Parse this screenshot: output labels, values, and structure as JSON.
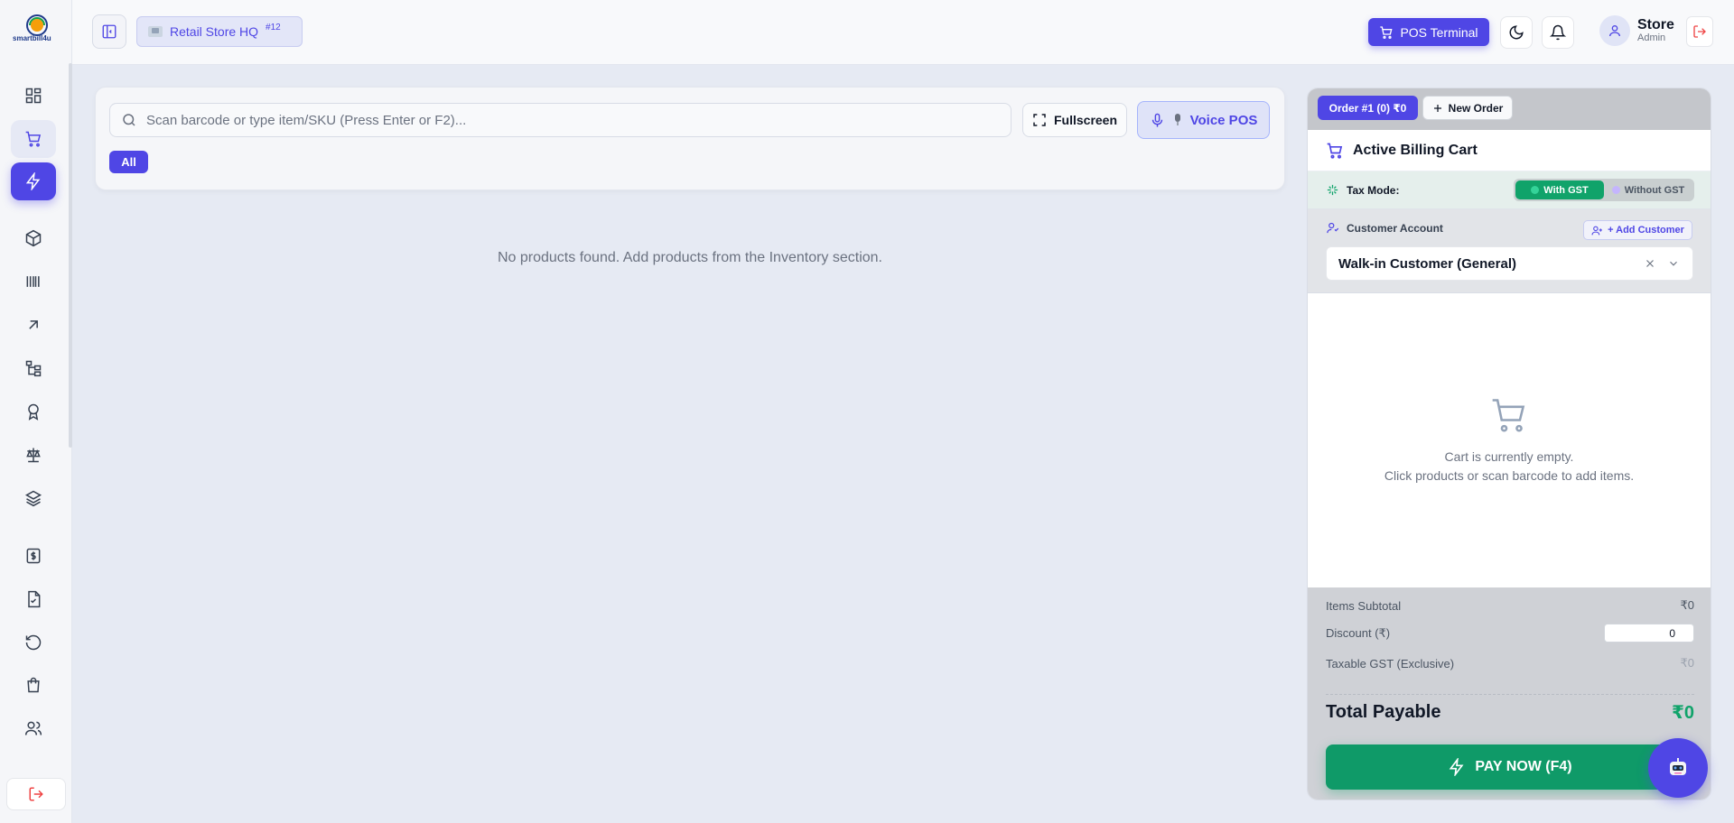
{
  "brand": {
    "logo_text": "smartbill4u"
  },
  "sidebar": {
    "items": [
      {
        "name": "dashboard",
        "icon": "grid-icon"
      },
      {
        "name": "pos",
        "icon": "cart-icon"
      },
      {
        "name": "quick-billing",
        "icon": "lightning-icon"
      },
      {
        "name": "products",
        "icon": "box-icon"
      },
      {
        "name": "barcodes",
        "icon": "barcode-icon"
      },
      {
        "name": "purchases",
        "icon": "arrow-up-right-icon"
      },
      {
        "name": "categories",
        "icon": "hierarchy-icon"
      },
      {
        "name": "loyalty",
        "icon": "award-icon"
      },
      {
        "name": "accounts",
        "icon": "scale-icon"
      },
      {
        "name": "stock",
        "icon": "layers-icon"
      },
      {
        "name": "expenses",
        "icon": "receipt-icon"
      },
      {
        "name": "reports",
        "icon": "file-check-icon"
      },
      {
        "name": "returns",
        "icon": "undo-icon"
      },
      {
        "name": "orders",
        "icon": "bag-icon"
      },
      {
        "name": "customers",
        "icon": "users-icon"
      }
    ]
  },
  "topbar": {
    "store_name": "Retail Store HQ",
    "store_id": "#12",
    "pos_button": "POS Terminal",
    "user_name": "Store",
    "user_role": "Admin"
  },
  "search": {
    "placeholder": "Scan barcode or type item/SKU (Press Enter or F2)...",
    "fullscreen_label": "Fullscreen",
    "voice_label": "Voice POS",
    "category_all": "All"
  },
  "main": {
    "empty_message": "No products found. Add products from the Inventory section."
  },
  "cart": {
    "order_tab": "Order #1 (0) ₹0",
    "new_order": "New Order",
    "title": "Active Billing Cart",
    "tax_mode_label": "Tax Mode:",
    "tax_with": "With GST",
    "tax_without": "Without GST",
    "customer_label": "Customer Account",
    "add_customer": "+ Add Customer",
    "customer_selected": "Walk-in Customer (General)",
    "empty_line1": "Cart is currently empty.",
    "empty_line2": "Click products or scan barcode to add items.",
    "subtotal_label": "Items Subtotal",
    "subtotal_value": "₹0",
    "discount_label": "Discount (₹)",
    "discount_value": "0",
    "gst_label": "Taxable GST (Exclusive)",
    "gst_value": "₹0",
    "total_label": "Total Payable",
    "total_value": "₹0",
    "pay_label": "PAY NOW (F4)"
  },
  "colors": {
    "accent": "#4f46e5",
    "success": "#10a36a",
    "danger": "#ef4444"
  }
}
